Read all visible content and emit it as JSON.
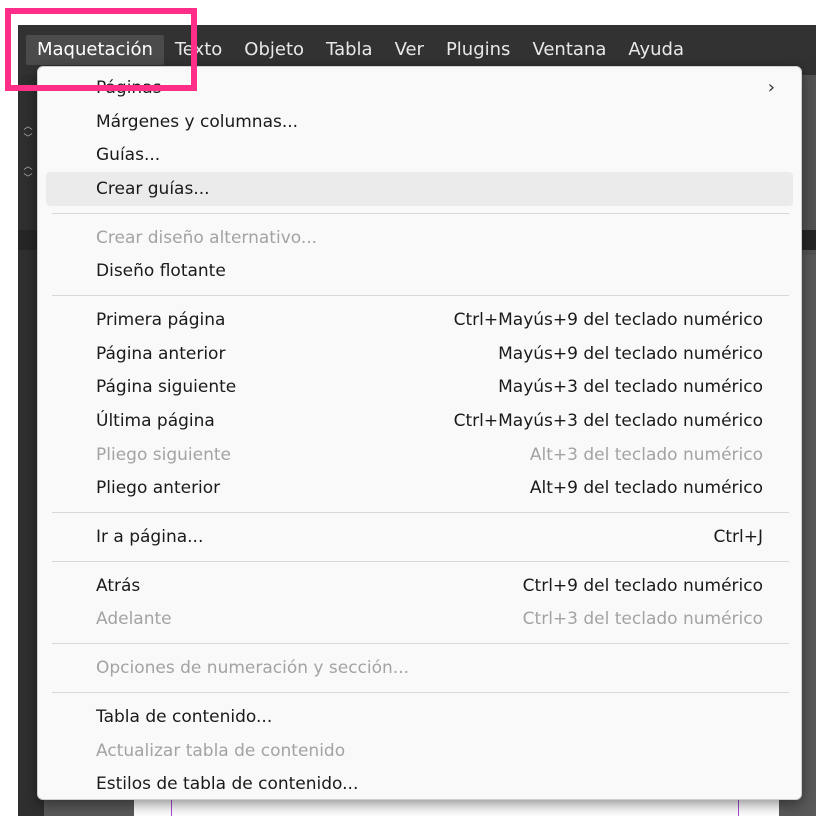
{
  "menubar": {
    "items": [
      {
        "label": "Maquetación",
        "active": true
      },
      {
        "label": "Texto"
      },
      {
        "label": "Objeto"
      },
      {
        "label": "Tabla"
      },
      {
        "label": "Ver"
      },
      {
        "label": "Plugins"
      },
      {
        "label": "Ventana"
      },
      {
        "label": "Ayuda"
      }
    ]
  },
  "dropdown": {
    "groups": [
      [
        {
          "label": "Páginas",
          "submenu": true,
          "submenu_glyph": "›"
        },
        {
          "label": "Márgenes y columnas..."
        },
        {
          "label": "Guías..."
        },
        {
          "label": "Crear guías...",
          "hover": true
        }
      ],
      [
        {
          "label": "Crear diseño alternativo...",
          "disabled": true
        },
        {
          "label": "Diseño flotante"
        }
      ],
      [
        {
          "label": "Primera página",
          "shortcut": "Ctrl+Mayús+9 del teclado numérico"
        },
        {
          "label": "Página anterior",
          "shortcut": "Mayús+9 del teclado numérico"
        },
        {
          "label": "Página siguiente",
          "shortcut": "Mayús+3 del teclado numérico"
        },
        {
          "label": "Última página",
          "shortcut": "Ctrl+Mayús+3 del teclado numérico"
        },
        {
          "label": "Pliego siguiente",
          "shortcut": "Alt+3 del teclado numérico",
          "disabled": true
        },
        {
          "label": "Pliego anterior",
          "shortcut": "Alt+9 del teclado numérico"
        }
      ],
      [
        {
          "label": "Ir a página...",
          "shortcut": "Ctrl+J"
        }
      ],
      [
        {
          "label": "Atrás",
          "shortcut": "Ctrl+9 del teclado numérico"
        },
        {
          "label": "Adelante",
          "shortcut": "Ctrl+3 del teclado numérico",
          "disabled": true
        }
      ],
      [
        {
          "label": "Opciones de numeración y sección...",
          "disabled": true
        }
      ],
      [
        {
          "label": "Tabla de contenido..."
        },
        {
          "label": "Actualizar tabla de contenido",
          "disabled": true
        },
        {
          "label": "Estilos de tabla de contenido..."
        }
      ]
    ]
  },
  "colors": {
    "highlight_box": "#ff2e88",
    "menubar_bg": "#323232",
    "menu_bg": "#f9f9f9",
    "disabled_text": "#a3a3a3",
    "guide": "#a64bd6"
  },
  "icons": {
    "stepper": "up-down-chevron-icon"
  }
}
